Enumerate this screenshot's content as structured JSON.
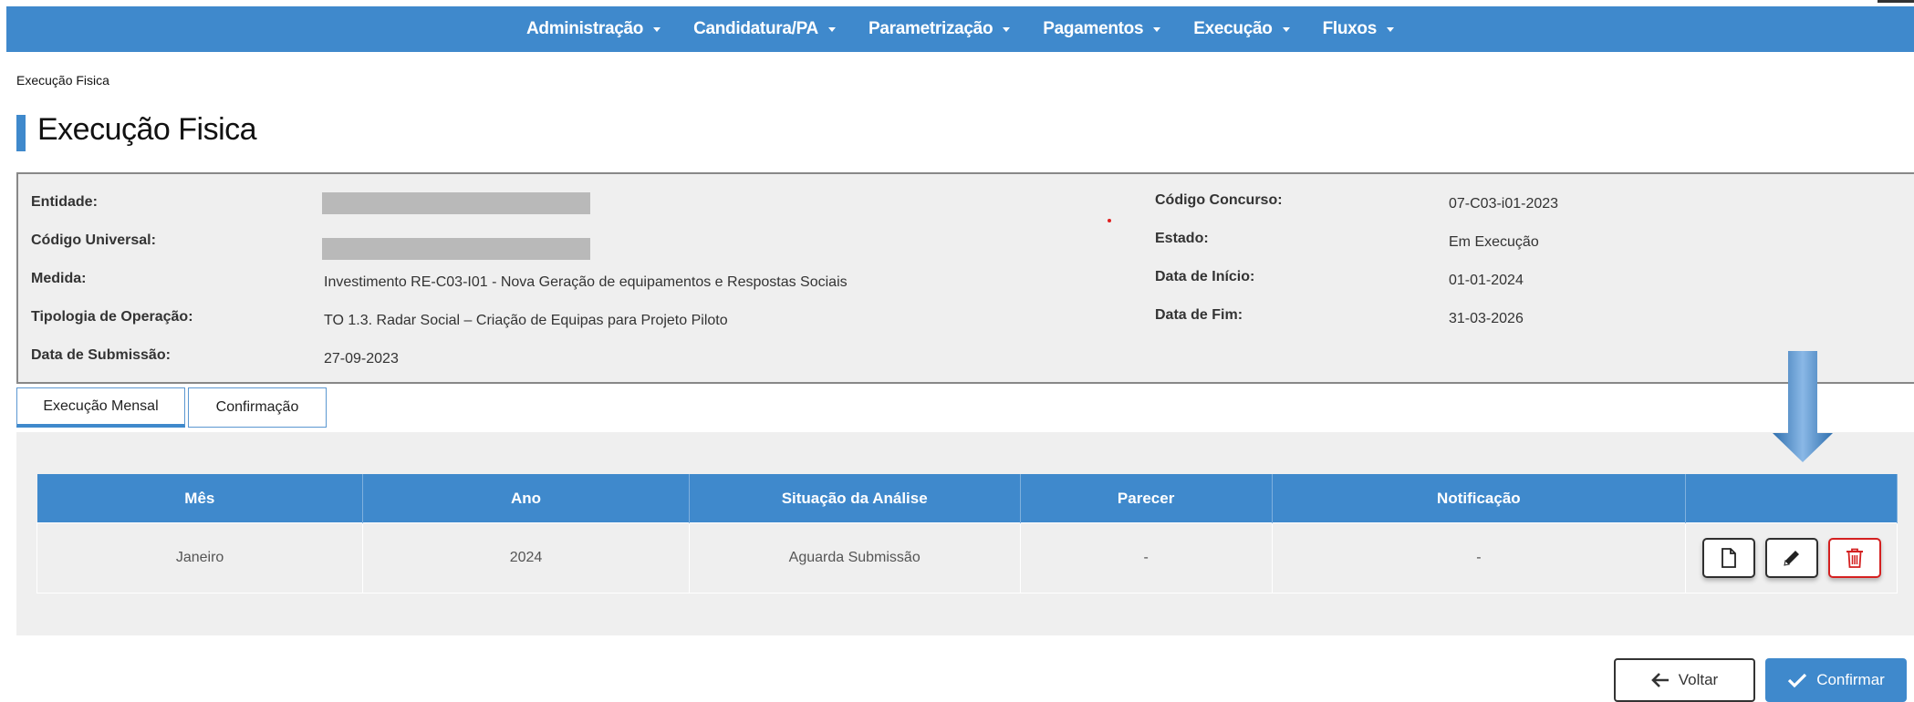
{
  "nav": {
    "items": [
      {
        "label": "Administração"
      },
      {
        "label": "Candidatura/PA"
      },
      {
        "label": "Parametrização"
      },
      {
        "label": "Pagamentos"
      },
      {
        "label": "Execução"
      },
      {
        "label": "Fluxos"
      }
    ]
  },
  "breadcrumb": "Execução Fisica",
  "page_title": "Execução Fisica",
  "info": {
    "entidade_label": "Entidade:",
    "codigo_universal_label": "Código Universal:",
    "medida_label": "Medida:",
    "medida_value": "Investimento RE-C03-I01 - Nova Geração de equipamentos e Respostas Sociais",
    "tipologia_label": "Tipologia de Operação:",
    "tipologia_value": "TO 1.3. Radar Social – Criação de Equipas para Projeto Piloto",
    "data_submissao_label": "Data de Submissão:",
    "data_submissao_value": "27-09-2023",
    "codigo_concurso_label": "Código Concurso:",
    "codigo_concurso_value": "07-C03-i01-2023",
    "estado_label": "Estado:",
    "estado_value": "Em Execução",
    "data_inicio_label": "Data de Início:",
    "data_inicio_value": "01-01-2024",
    "data_fim_label": "Data de Fim:",
    "data_fim_value": "31-03-2026"
  },
  "tabs": [
    {
      "label": "Execução Mensal",
      "active": true
    },
    {
      "label": "Confirmação",
      "active": false
    }
  ],
  "table": {
    "headers": [
      "Mês",
      "Ano",
      "Situação da Análise",
      "Parecer",
      "Notificação",
      ""
    ],
    "rows": [
      {
        "mes": "Janeiro",
        "ano": "2024",
        "situacao": "Aguarda Submissão",
        "parecer": "-",
        "notificacao": "-"
      }
    ],
    "row_action_icons": [
      "document-icon",
      "pencil-icon",
      "trash-icon"
    ]
  },
  "buttons": {
    "voltar": "Voltar",
    "confirmar": "Confirmar"
  },
  "colors": {
    "primary": "#3f89cc",
    "danger": "#d42020",
    "panel_bg": "#efefef"
  }
}
